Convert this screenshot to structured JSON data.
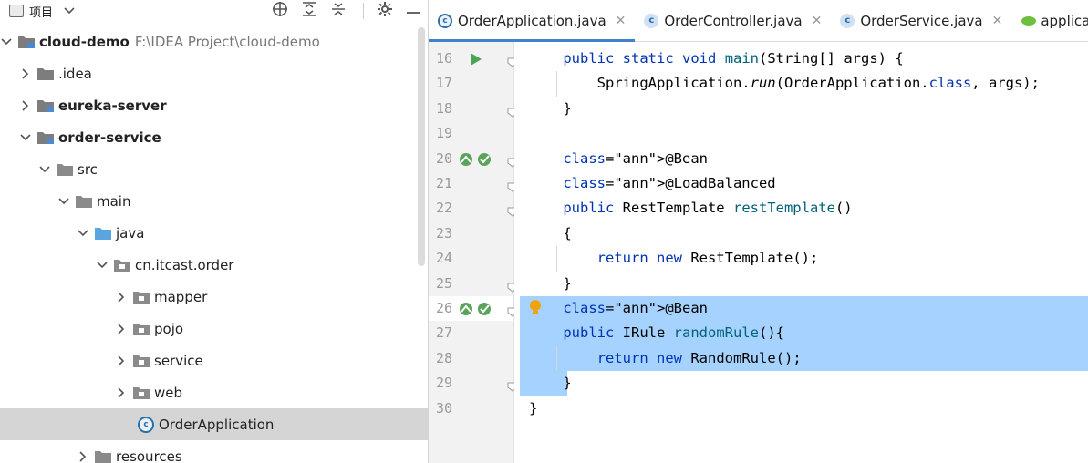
{
  "project_panel": {
    "title": "项目",
    "tree": [
      {
        "label": "cloud-demo",
        "path": "F:\\IDEA Project\\cloud-demo",
        "bold": true,
        "indent": 0,
        "expanded": true
      },
      {
        "label": ".idea",
        "indent": 1,
        "expanded": false
      },
      {
        "label": "eureka-server",
        "bold": true,
        "indent": 1,
        "expanded": false
      },
      {
        "label": "order-service",
        "bold": true,
        "indent": 1,
        "expanded": true
      },
      {
        "label": "src",
        "indent": 2,
        "expanded": true
      },
      {
        "label": "main",
        "indent": 3,
        "expanded": true
      },
      {
        "label": "java",
        "indent": 4,
        "expanded": true
      },
      {
        "label": "cn.itcast.order",
        "indent": 5,
        "expanded": true
      },
      {
        "label": "mapper",
        "indent": 6,
        "expanded": false
      },
      {
        "label": "pojo",
        "indent": 6,
        "expanded": false
      },
      {
        "label": "service",
        "indent": 6,
        "expanded": false
      },
      {
        "label": "web",
        "indent": 6,
        "expanded": false
      },
      {
        "label": "OrderApplication",
        "indent": 7,
        "selected": true
      },
      {
        "label": "resources",
        "indent": 4,
        "expanded": false
      }
    ]
  },
  "tabs": [
    {
      "label": "OrderApplication.java",
      "active": true,
      "closable": true
    },
    {
      "label": "OrderController.java",
      "closable": true
    },
    {
      "label": "OrderService.java",
      "closable": true
    },
    {
      "label": "applicati",
      "closable": false
    }
  ],
  "line_numbers": [
    "16",
    "17",
    "18",
    "19",
    "20",
    "21",
    "22",
    "23",
    "24",
    "25",
    "26",
    "27",
    "28",
    "29",
    "30"
  ],
  "code_lines": [
    "    public static void main(String[] args) {",
    "        SpringApplication.run(OrderApplication.class, args);",
    "    }",
    "",
    "    @Bean",
    "    @LoadBalanced",
    "    public RestTemplate restTemplate()",
    "    {",
    "        return new RestTemplate();",
    "    }",
    "    @Bean",
    "    public IRule randomRule(){",
    "        return new RandomRule();",
    "    }",
    "}"
  ],
  "colors": {
    "keyword": "#0033b3",
    "annotation": "#9e880d",
    "method": "#00627a",
    "selection": "#a6d2ff"
  }
}
